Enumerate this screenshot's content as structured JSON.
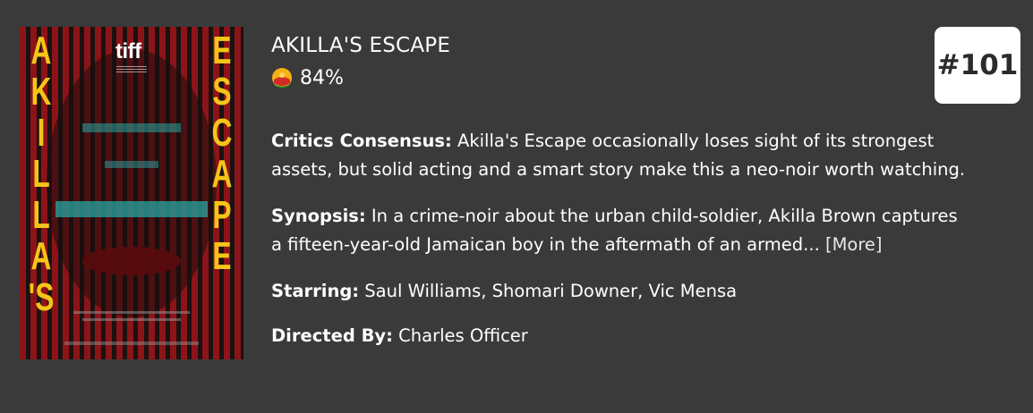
{
  "movie": {
    "title": "AKILLA'S ESCAPE",
    "score": "84%",
    "score_icon": "certified-fresh-icon",
    "rank": "#101",
    "poster": {
      "letters_left": [
        "A",
        "K",
        "I",
        "L",
        "L",
        "A",
        "'S"
      ],
      "letters_right": [
        "E",
        "S",
        "C",
        "A",
        "P",
        "E"
      ],
      "logo_text": "tiff",
      "colors": {
        "red": "#8c1419",
        "yellow": "#f4c518",
        "teal": "#2aa6a3"
      }
    },
    "consensus_label": "Critics Consensus:",
    "consensus_line1": "Akilla's Escape occasionally loses sight of its strongest",
    "consensus_line2": "assets, but solid acting and a smart story make this a neo-noir worth watching.",
    "synopsis_label": "Synopsis:",
    "synopsis_line1": "In a crime-noir about the urban child-soldier, Akilla Brown captures",
    "synopsis_line2": "a fifteen-year-old Jamaican boy in the aftermath of an armed...",
    "more_label": "[More]",
    "starring_label": "Starring:",
    "starring_value": "Saul Williams, Shomari Downer, Vic Mensa",
    "directed_label": "Directed By:",
    "directed_value": "Charles Officer"
  }
}
